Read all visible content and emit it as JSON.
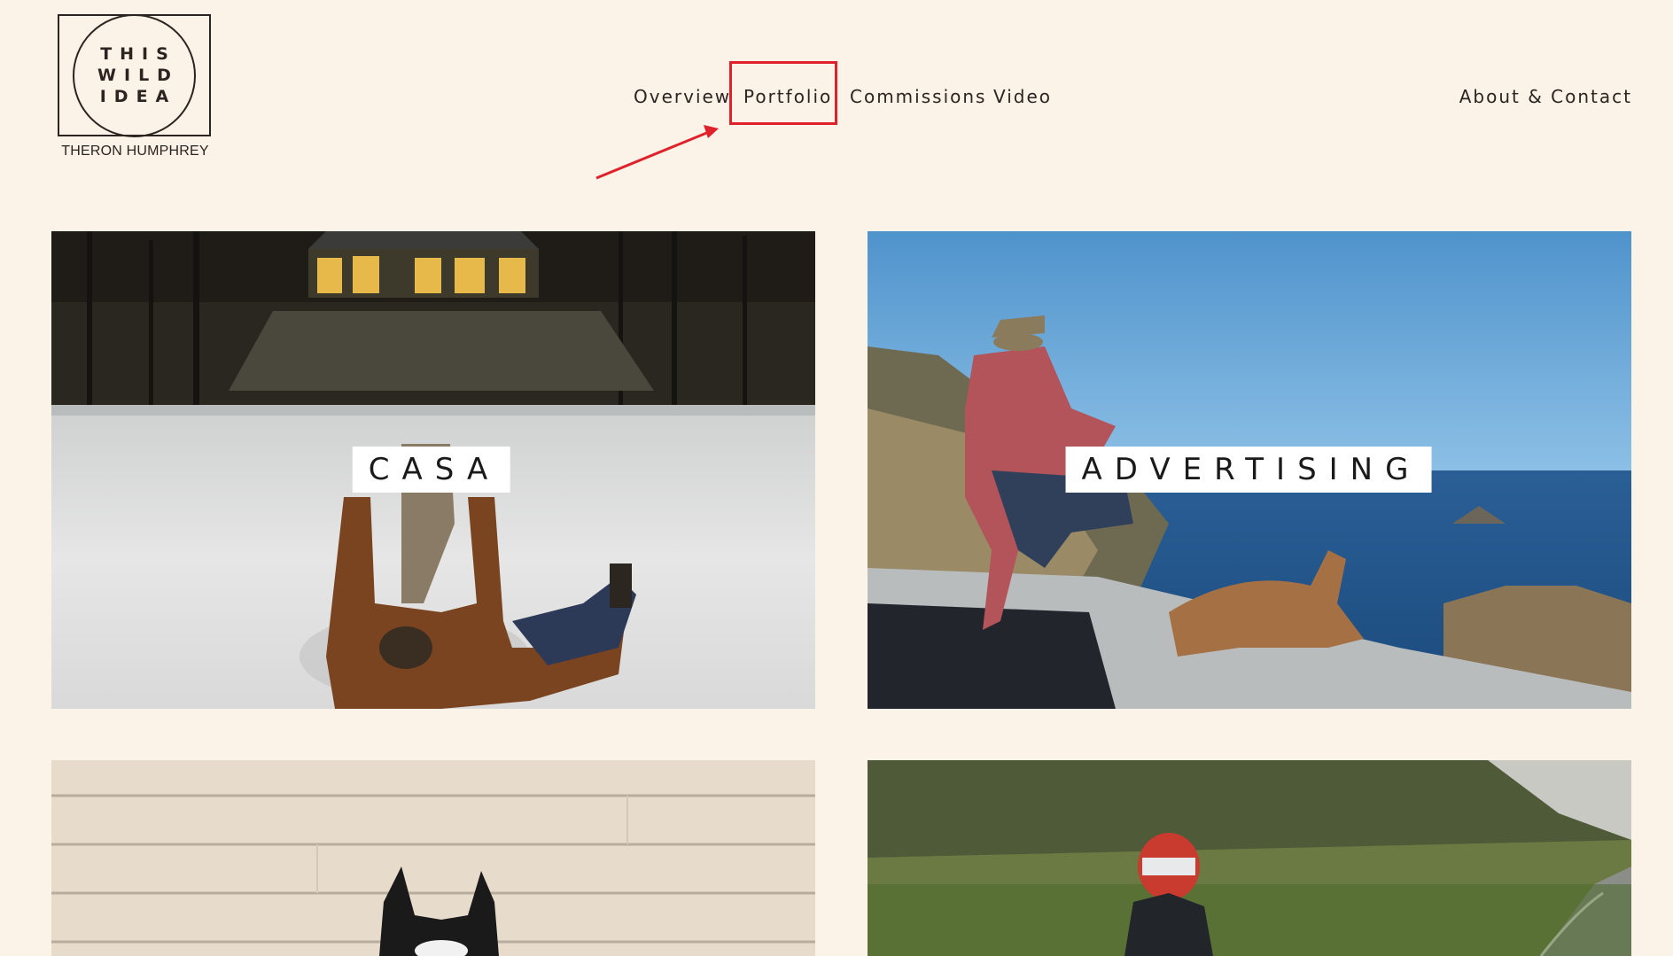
{
  "logo": {
    "line1": "THIS",
    "line2": "WILD",
    "line3": "IDEA",
    "subtitle": "THERON HUMPHREY"
  },
  "nav": {
    "overview": "Overview",
    "portfolio": "Portfolio",
    "commissions": "Commissions",
    "video": "Video",
    "about_contact": "About & Contact"
  },
  "tiles": [
    {
      "label": "CASA"
    },
    {
      "label": "ADVERTISING"
    },
    {
      "label": ""
    },
    {
      "label": ""
    }
  ],
  "colors": {
    "background": "#fbf3e7",
    "text": "#2b2420",
    "highlight": "#e0202a"
  }
}
